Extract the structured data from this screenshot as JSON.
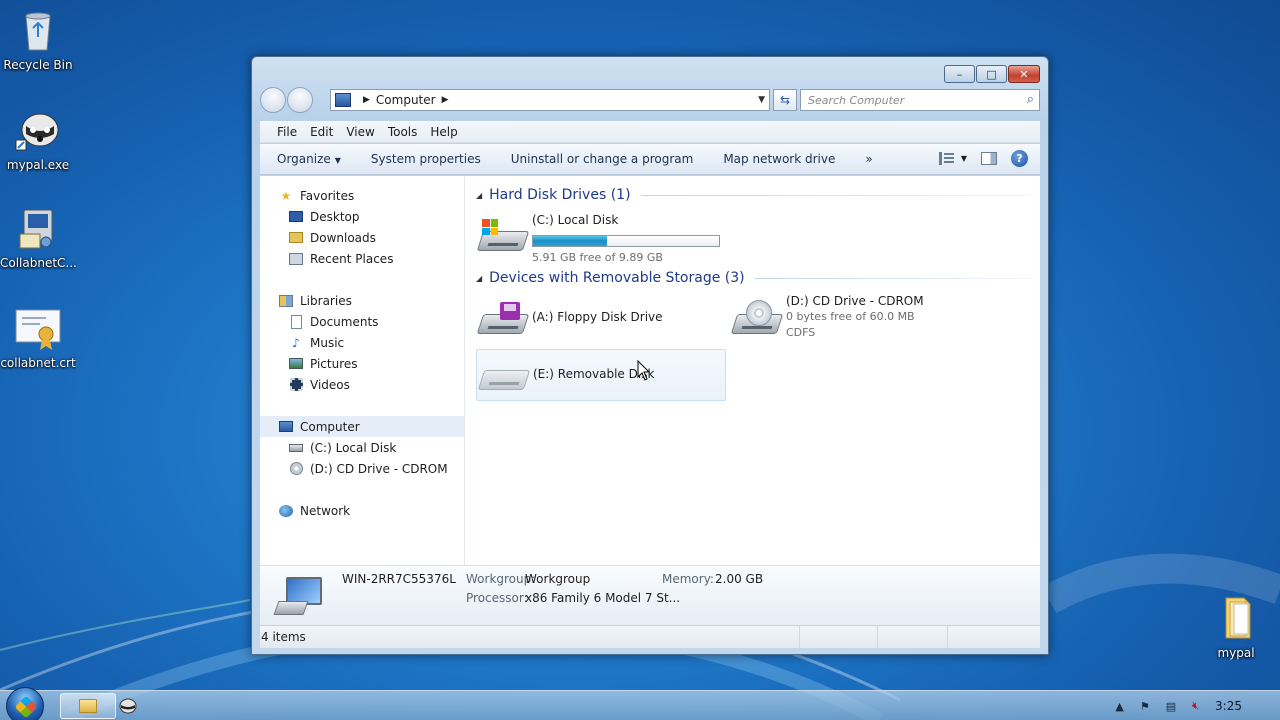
{
  "desktop": {
    "icons": [
      {
        "label": "Recycle Bin",
        "icon": "recycle-bin-icon"
      },
      {
        "label": "mypal.exe",
        "icon": "raccoon-app-icon"
      },
      {
        "label": "CollabnetC...",
        "icon": "computer-installer-icon"
      },
      {
        "label": "collabnet.crt",
        "icon": "certificate-icon"
      },
      {
        "label": "mypal",
        "icon": "folder-icon"
      }
    ]
  },
  "window": {
    "controls": {
      "minimize": "–",
      "maximize": "□",
      "close": "✕"
    },
    "address": {
      "crumb": "Computer"
    },
    "search": {
      "placeholder": "Search Computer"
    },
    "menu": [
      "File",
      "Edit",
      "View",
      "Tools",
      "Help"
    ],
    "toolbar": {
      "organize": "Organize",
      "system_properties": "System properties",
      "uninstall": "Uninstall or change a program",
      "map_drive": "Map network drive",
      "more": "»"
    },
    "nav": {
      "favorites": "Favorites",
      "desktop": "Desktop",
      "downloads": "Downloads",
      "recent": "Recent Places",
      "libraries": "Libraries",
      "documents": "Documents",
      "music": "Music",
      "pictures": "Pictures",
      "videos": "Videos",
      "computer": "Computer",
      "local_disk": "(C:) Local Disk",
      "cd_drive": "(D:) CD Drive - CDROM",
      "network": "Network"
    },
    "groups": {
      "hdd": "Hard Disk Drives (1)",
      "removable": "Devices with Removable Storage (3)"
    },
    "drives": {
      "c": {
        "name": "(C:) Local Disk",
        "free": "5.91 GB free of 9.89 GB",
        "used_fraction": 0.4
      },
      "a": {
        "name": "(A:) Floppy Disk Drive"
      },
      "d": {
        "name": "(D:) CD Drive - CDROM",
        "free": "0 bytes free of 60.0 MB",
        "fs": "CDFS"
      },
      "e": {
        "name": "(E:) Removable Disk"
      }
    },
    "details": {
      "computer_name": "WIN-2RR7C55376L",
      "workgroup_label": "Workgroup:",
      "workgroup": "Workgroup",
      "memory_label": "Memory:",
      "memory": "2.00 GB",
      "processor_label": "Processor:",
      "processor": "x86 Family 6 Model 7 St..."
    },
    "status": {
      "items": "4 items"
    }
  },
  "taskbar": {
    "clock": "3:25",
    "tray_arrow": "▲"
  },
  "colors": {
    "accent": "#1e3a8a",
    "capacity_fill": "#1b8ec6"
  }
}
